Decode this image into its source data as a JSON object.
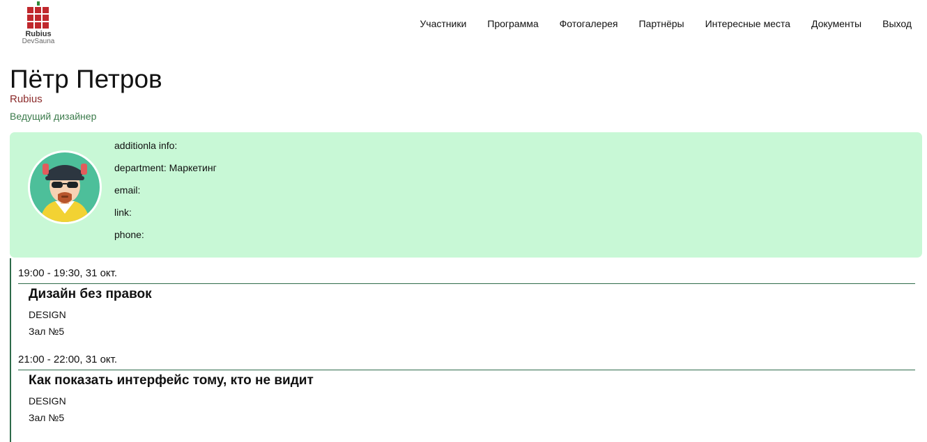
{
  "header": {
    "logo": {
      "name": "Rubius",
      "subtitle": "DevSauna",
      "icon": "grid-logo-icon",
      "color": "#c0282d"
    },
    "nav": [
      {
        "label": "Участники",
        "name": "nav-participants"
      },
      {
        "label": "Программа",
        "name": "nav-program"
      },
      {
        "label": "Фотогалерея",
        "name": "nav-photo-gallery"
      },
      {
        "label": "Партнёры",
        "name": "nav-partners"
      },
      {
        "label": "Интересные места",
        "name": "nav-places"
      },
      {
        "label": "Документы",
        "name": "nav-documents"
      },
      {
        "label": "Выход",
        "name": "nav-logout"
      }
    ]
  },
  "profile": {
    "name": "Пётр Петров",
    "company": "Rubius",
    "position": "Ведущий дизайнер",
    "avatar_icon": "avatar-illustration-icon",
    "details": [
      {
        "label": "additionla info:",
        "value": ""
      },
      {
        "label": "department:",
        "value": "Маркетинг"
      },
      {
        "label": "email:",
        "value": ""
      },
      {
        "label": "link:",
        "value": ""
      },
      {
        "label": "phone:",
        "value": ""
      }
    ]
  },
  "sessions": [
    {
      "time": "19:00 - 19:30, 31 окт.",
      "title": "Дизайн без правок",
      "track": "DESIGN",
      "room": "Зал №5"
    },
    {
      "time": "21:00 - 22:00, 31 окт.",
      "title": "Как показать интерфейс тому, кто не видит",
      "track": "DESIGN",
      "room": "Зал №5"
    }
  ],
  "colors": {
    "card_bg": "#c8f8d6",
    "company": "#8b2a2a",
    "position": "#3a7a4a",
    "accent_line": "#2e6b4a"
  }
}
